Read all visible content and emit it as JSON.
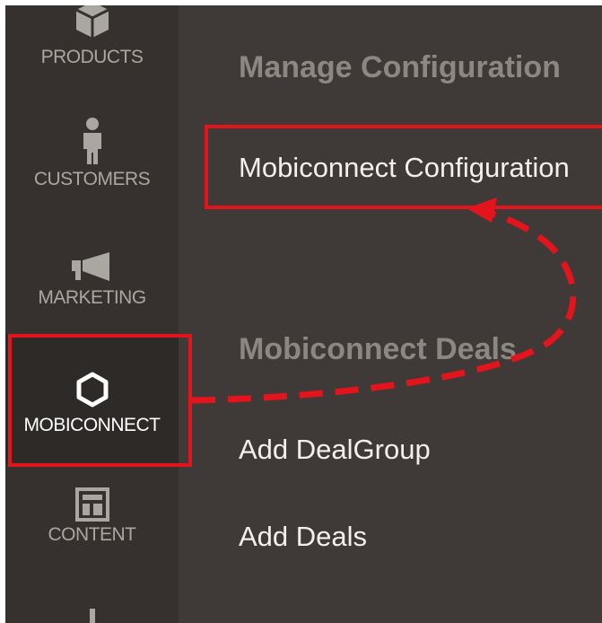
{
  "sidebar": {
    "items": [
      {
        "label": "PRODUCTS",
        "icon": "box-icon"
      },
      {
        "label": "CUSTOMERS",
        "icon": "person-icon"
      },
      {
        "label": "MARKETING",
        "icon": "megaphone-icon"
      },
      {
        "label": "MOBICONNECT",
        "icon": "hexagon-icon"
      },
      {
        "label": "CONTENT",
        "icon": "layout-icon"
      }
    ]
  },
  "submenu": {
    "groups": [
      {
        "title": "Manage Configuration",
        "links": [
          "Mobiconnect Configuration"
        ]
      },
      {
        "title": "Mobiconnect Deals",
        "links": [
          "Add DealGroup",
          "Add Deals"
        ]
      }
    ]
  },
  "colors": {
    "sidebar_bg": "#36312f",
    "panel_bg": "#3f3a37",
    "active_bg": "#2e2a28",
    "highlight": "#e3141b",
    "heading": "#8d8781",
    "link": "#f2efec"
  }
}
